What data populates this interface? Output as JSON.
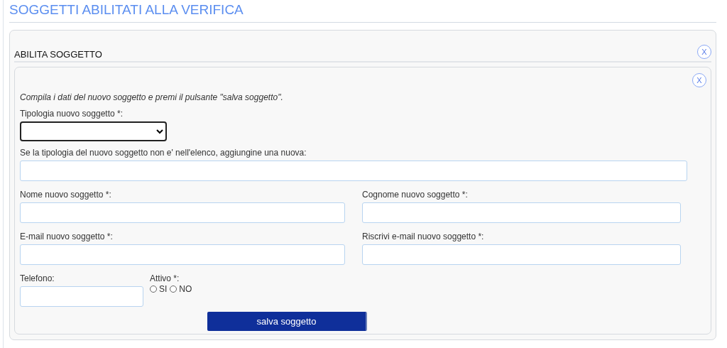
{
  "page_title": "SOGGETTI ABILITATI ALLA VERIFICA",
  "panel": {
    "title": "ABILITA SOGGETTO",
    "close": "X"
  },
  "form": {
    "close": "X",
    "instructions": "Compila i dati del nuovo soggetto e premi il pulsante \"salva soggetto\".",
    "type_label": "Tipologia nuovo soggetto *:",
    "new_type_label": "Se la tipologia del nuovo soggetto non e' nell'elenco, aggiungine una nuova:",
    "rows": [
      [
        {
          "label": "Nome nuovo soggetto *:"
        },
        {
          "label": "Cognome nuovo soggetto *:"
        }
      ],
      [
        {
          "label": "E-mail nuovo soggetto *:"
        },
        {
          "label": "Riscrivi e-mail nuovo soggetto *:"
        }
      ]
    ],
    "phone_label": "Telefono:",
    "active": {
      "label": "Attivo *:",
      "options": [
        {
          "label": "SI",
          "selected": false
        },
        {
          "label": "NO",
          "selected": false
        }
      ]
    },
    "save_button": "salva soggetto"
  }
}
